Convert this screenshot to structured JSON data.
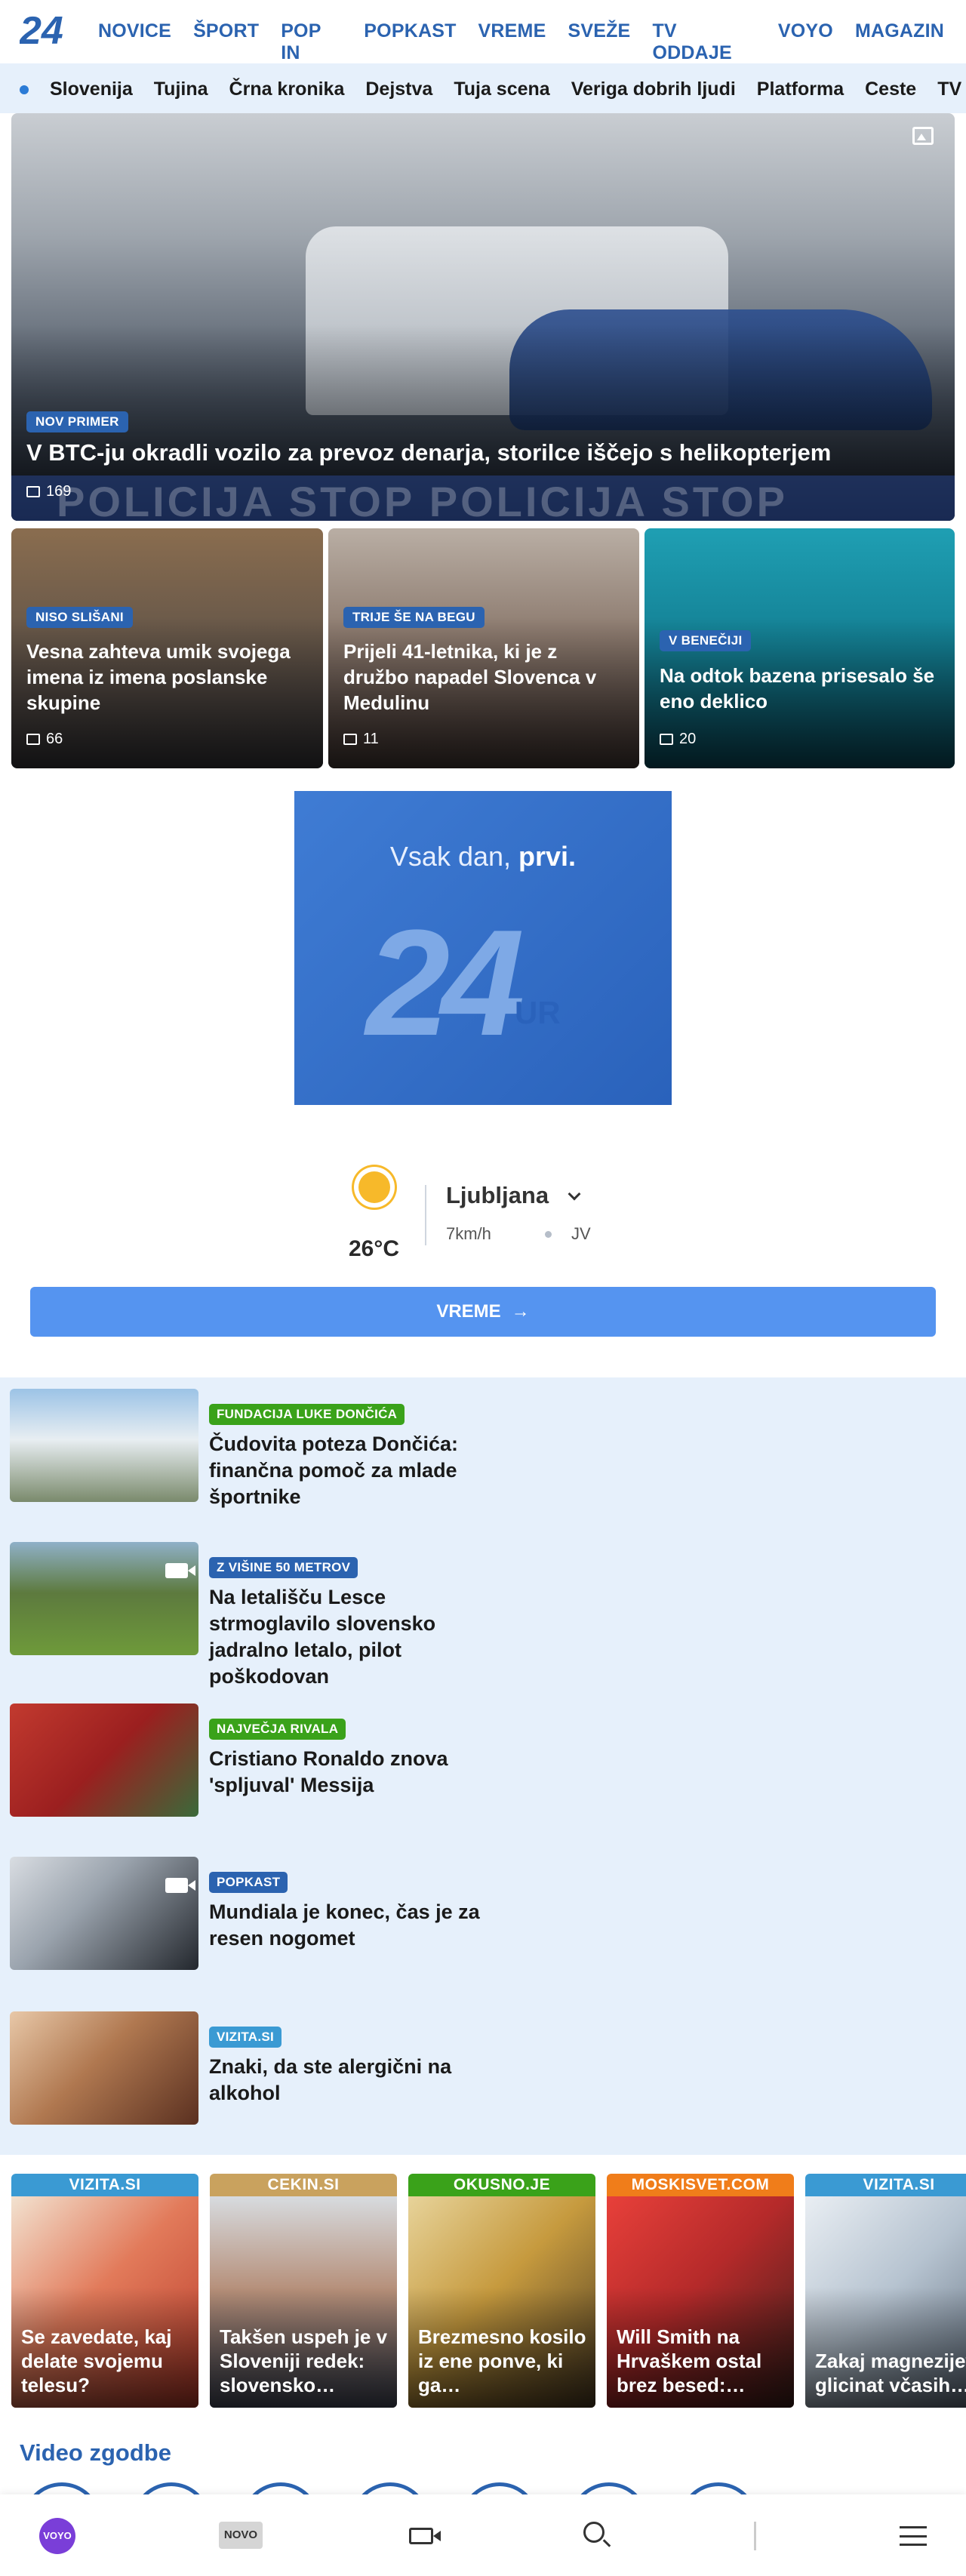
{
  "brand": {
    "logo_text": "24"
  },
  "topnav": [
    "NOVICE",
    "ŠPORT",
    "POP IN",
    "POPKAST",
    "VREME",
    "SVEŽE",
    "TV ODDAJE",
    "VOYO",
    "MAGAZIN"
  ],
  "subnav": [
    "Slovenija",
    "Tujina",
    "Črna kronika",
    "Dejstva",
    "Tuja scena",
    "Veriga dobrih ljudi",
    "Platforma",
    "Ceste",
    "TV spored"
  ],
  "hero": {
    "badge": "NOV PRIMER",
    "title": "V BTC-ju okradli vozilo za prevoz denarja, storilce iščejo s helikopterjem",
    "comments": "169",
    "tape_text": "POLICIJA STOP POLICIJA STOP"
  },
  "cards": [
    {
      "badge": "NISO SLIŠANI",
      "title": "Vesna zahteva umik svojega imena iz imena poslanske skupine",
      "comments": "66"
    },
    {
      "badge": "TRIJE ŠE NA BEGU",
      "title": "Prijeli 41-letnika, ki je z družbo napadel Slovenca v Medulinu",
      "comments": "11"
    },
    {
      "badge": "V BENEČIJI",
      "title": "Na odtok bazena prisesalo še eno deklico",
      "comments": "20"
    }
  ],
  "ad": {
    "slogan_prefix": "Vsak dan, ",
    "slogan_bold": "prvi.",
    "number": "24",
    "suffix": "UR"
  },
  "weather": {
    "temperature": "26°C",
    "city": "Ljubljana",
    "wind": "7km/h",
    "direction": "JV",
    "button": "VREME",
    "icon": "sun-icon"
  },
  "list": [
    {
      "badge": "FUNDACIJA LUKE DONČIĆA",
      "badge_color": "#3aa21a",
      "title": "Čudovita poteza Dončića: finančna pomoč za mlade športnike",
      "video": false
    },
    {
      "badge": "Z VIŠINE 50 METROV",
      "badge_color": "#2b63b0",
      "title": "Na letališču Lesce strmoglavilo slovensko jadralno letalo, pilot poškodovan",
      "video": true
    },
    {
      "badge": "NAJVEČJA RIVALA",
      "badge_color": "#3aa21a",
      "title": "Cristiano Ronaldo znova 'spljuval' Messija",
      "video": false
    },
    {
      "badge": "POPKAST",
      "badge_color": "#2b63b0",
      "title": "Mundiala je konec, čas je za resen nogomet",
      "video": true
    },
    {
      "badge": "VIZITA.SI",
      "badge_color": "#3a9ad3",
      "title": "Znaki, da ste alergični na alkohol",
      "video": false
    }
  ],
  "partners": [
    {
      "label": "VIZITA.SI",
      "color": "#3a9ad3",
      "title": "Se zavedate, kaj delate svojemu telesu?"
    },
    {
      "label": "CEKIN.SI",
      "color": "#c9a25e",
      "title": "Takšen uspeh je v Sloveniji redek: slovensko…"
    },
    {
      "label": "OKUSNO.JE",
      "color": "#3aa21a",
      "title": "Brezmesno kosilo iz ene ponve, ki ga…"
    },
    {
      "label": "MOSKISVET.COM",
      "color": "#f07d1a",
      "title": "Will Smith na Hrvaškem ostal brez besed:…"
    },
    {
      "label": "VIZITA.SI",
      "color": "#3a9ad3",
      "title": "Zakaj magnezijev glicinat včasih…"
    }
  ],
  "video_section": {
    "title": "Video zgodbe"
  },
  "bottombar": {
    "voyo": "VOYO",
    "novo": "NOVO"
  }
}
